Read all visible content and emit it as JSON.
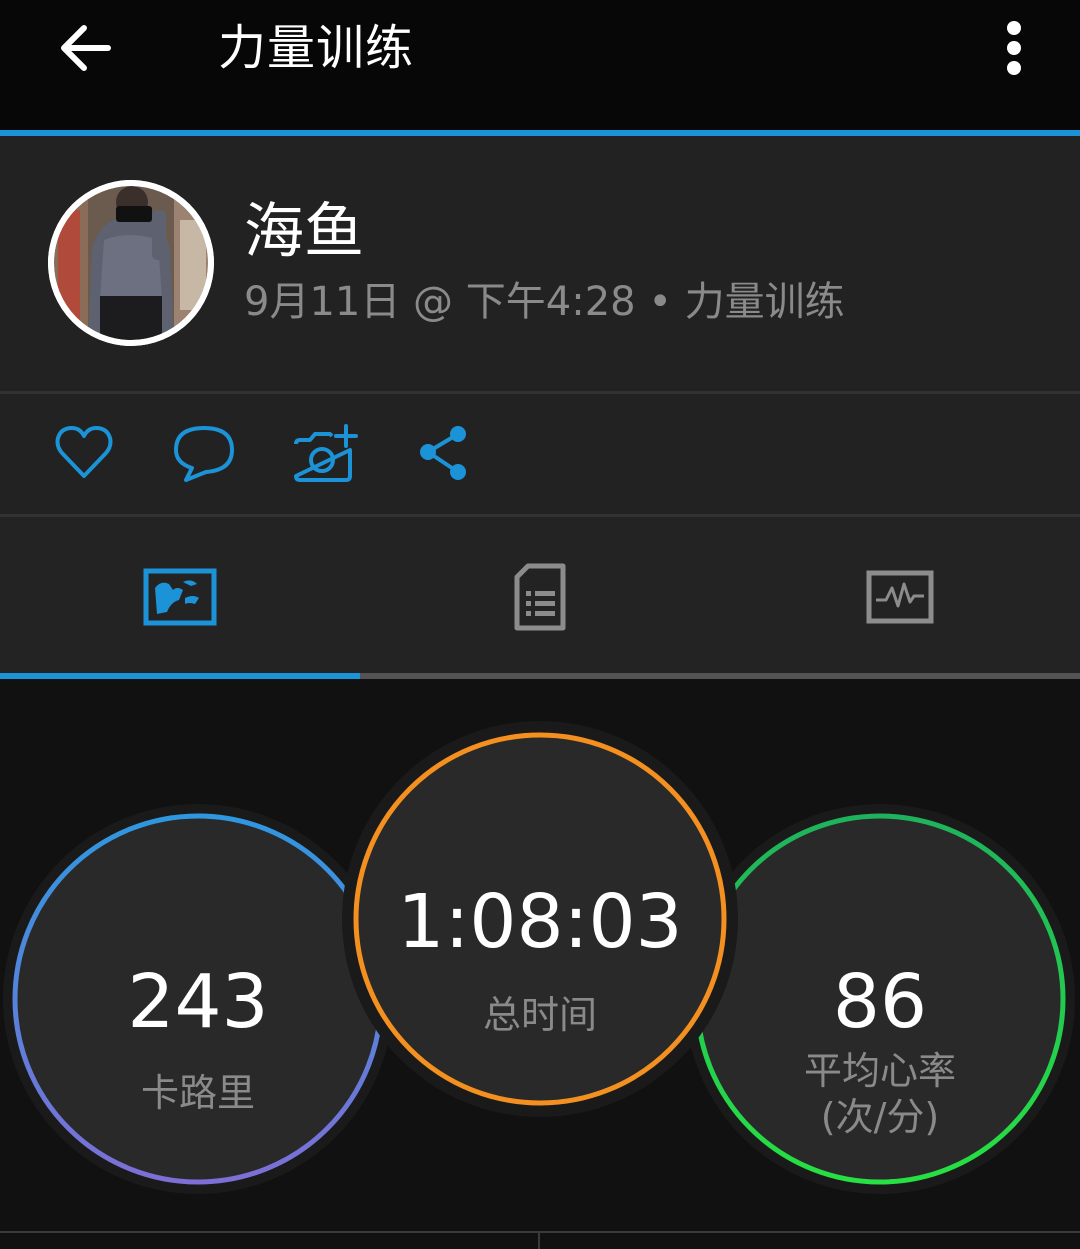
{
  "header": {
    "title": "力量训练",
    "back_icon": "arrow-left-icon",
    "menu_icon": "more-vertical-icon"
  },
  "profile": {
    "name": "海鱼",
    "meta": "9月11日 @ 下午4:28 • 力量训练"
  },
  "actions": [
    {
      "icon": "heart-icon"
    },
    {
      "icon": "comment-icon"
    },
    {
      "icon": "add-photo-icon"
    },
    {
      "icon": "share-icon"
    }
  ],
  "tabs": [
    {
      "icon": "overview-map-icon",
      "active": true
    },
    {
      "icon": "details-document-icon",
      "active": false
    },
    {
      "icon": "chart-activity-icon",
      "active": false
    }
  ],
  "stats": {
    "calories": {
      "value": "243",
      "label": "卡路里"
    },
    "total_time": {
      "value": "1:08:03",
      "label": "总时间"
    },
    "avg_hr": {
      "value": "86",
      "label": "平均心率",
      "unit": "(次/分)"
    }
  },
  "colors": {
    "accent_blue": "#1b93d6",
    "ring_calories_top": "#2f97e0",
    "ring_calories_bottom": "#7d6fd6",
    "ring_time": "#f4901f",
    "ring_hr": "#27e043",
    "text_muted": "#8a8a8a"
  }
}
